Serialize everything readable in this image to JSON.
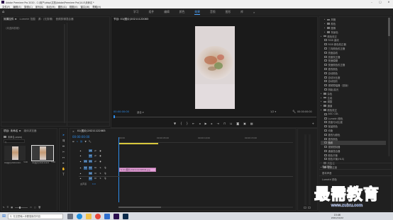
{
  "title_bar": {
    "app_title": "Adobe Premiere Pro 2020 - C:\\用户\\ddsp\\文档\\Adobe\\Premiere Pro\\14.0\\未命名 *",
    "window_controls": [
      "–",
      "□",
      "✕"
    ]
  },
  "menu_bar": [
    "文件(F)",
    "编辑(E)",
    "剪辑(C)",
    "序列(S)",
    "标记(M)",
    "图形(G)",
    "视图(V)",
    "窗口(W)",
    "帮助(H)"
  ],
  "workspace_tabs": {
    "items": [
      "学习",
      "组件",
      "编辑",
      "颜色",
      "效果",
      "音频",
      "图形",
      "库"
    ],
    "active": "效果",
    "more": "»"
  },
  "source_panel": {
    "tabs": [
      "效果控件 ≡",
      "Lumetri 范围",
      "源：(无剪辑)",
      "音频剪辑混合器"
    ],
    "content_label": "（未选择剪辑）"
  },
  "program_monitor": {
    "tab": "节目: 01(图片)20211122083",
    "timecode_left": "00:00:00:00",
    "fit": "适合",
    "fraction": "1/2",
    "timecode_right": "00:00:00:00"
  },
  "effects_panel": {
    "items": [
      {
        "label": "风格",
        "level": 1,
        "icon": false
      },
      {
        "label": "颜色",
        "level": 1,
        "icon": false
      },
      {
        "label": "图像",
        "level": 1,
        "icon": false
      },
      {
        "label": "背景色",
        "level": 1,
        "icon": false
      },
      {
        "label": "颜色校正",
        "level": 0,
        "icon": false
      },
      {
        "label": "RGB 曲线",
        "level": 1,
        "icon": true
      },
      {
        "label": "RGB 颜色校正器",
        "level": 1,
        "icon": true
      },
      {
        "label": "三向颜色校正器",
        "level": 1,
        "icon": true
      },
      {
        "label": "亮度曲线",
        "level": 1,
        "icon": true
      },
      {
        "label": "亮度校正器",
        "level": 1,
        "icon": true
      },
      {
        "label": "快速模糊",
        "level": 1,
        "icon": true
      },
      {
        "label": "快速颜色校正器",
        "level": 1,
        "icon": true
      },
      {
        "label": "更改颜色",
        "level": 1,
        "icon": true
      },
      {
        "label": "自动颜色",
        "level": 1,
        "icon": true
      },
      {
        "label": "自动对比度",
        "level": 1,
        "icon": true
      },
      {
        "label": "自动色阶",
        "level": 1,
        "icon": true
      },
      {
        "label": "视频限幅器（旧版）",
        "level": 1,
        "icon": true
      },
      {
        "label": "阴影/高光",
        "level": 1,
        "icon": true
      },
      {
        "label": "杂色",
        "level": 0,
        "icon": false
      },
      {
        "label": "生成",
        "level": 0,
        "icon": false
      },
      {
        "label": "调整",
        "level": 0,
        "icon": false
      },
      {
        "label": "通道",
        "level": 0,
        "icon": false
      },
      {
        "label": "颜色校正",
        "level": 0,
        "icon": false
      },
      {
        "label": "ASC CDL",
        "level": 1,
        "icon": true
      },
      {
        "label": "Lumetri 颜色",
        "level": 1,
        "icon": true
      },
      {
        "label": "亮度与对比度",
        "level": 1,
        "icon": true
      },
      {
        "label": "保留颜色",
        "level": 1,
        "icon": true
      },
      {
        "label": "均衡",
        "level": 1,
        "icon": true
      },
      {
        "label": "更改为颜色",
        "level": 1,
        "icon": true
      },
      {
        "label": "更改颜色",
        "level": 1,
        "icon": true
      },
      {
        "label": "色彩",
        "level": 1,
        "icon": true,
        "selected": true
      },
      {
        "label": "视频限制器",
        "level": 1,
        "icon": true
      },
      {
        "label": "通道混合器",
        "level": 1,
        "icon": true
      },
      {
        "label": "颜色平衡",
        "level": 1,
        "icon": true
      },
      {
        "label": "颜色平衡(HLS)",
        "level": 1,
        "icon": true
      },
      {
        "label": "风格化",
        "level": 0,
        "icon": false
      },
      {
        "label": "视频过渡",
        "level": 0,
        "icon": false
      }
    ],
    "bottom_sections": [
      "基本图形",
      "基本声音",
      "Lumetri 颜色"
    ]
  },
  "project_panel": {
    "tabs": [
      "项目: 未命名 ≡",
      "媒体浏览器"
    ],
    "project_name": "未命名.prproj",
    "clips": [
      {
        "name": "01(图片)20211122...",
        "duration": "5:00"
      },
      {
        "name": "01(图片)20211122083...",
        "duration": "5:00"
      }
    ]
  },
  "timeline": {
    "tab": "01(图片)20211122083",
    "timecode": "00:00:00:00",
    "ruler_labels": [
      ":00:00",
      "00:00:05:00",
      "00:00:10:00",
      "00:00:15:00"
    ],
    "video_tracks": [
      "V3",
      "V2",
      "V1"
    ],
    "audio_tracks": [
      "A1",
      "A2",
      "A3"
    ],
    "master_label": "主声道",
    "master_value": "0.0",
    "clip_label": "fx 01(图片)2021112208304.jpg"
  },
  "taskbar": {
    "search_placeholder": "在这里输入你要搜索的内容",
    "time": "15:46",
    "date": "2021/11/22"
  },
  "watermark": {
    "cn": "最需教育",
    "en": "www.zuixu.com"
  },
  "colors": {
    "accent_blue": "#2d8ceb",
    "clip_pink": "#e5a1d9",
    "selected_row": "#3b3b3b"
  }
}
